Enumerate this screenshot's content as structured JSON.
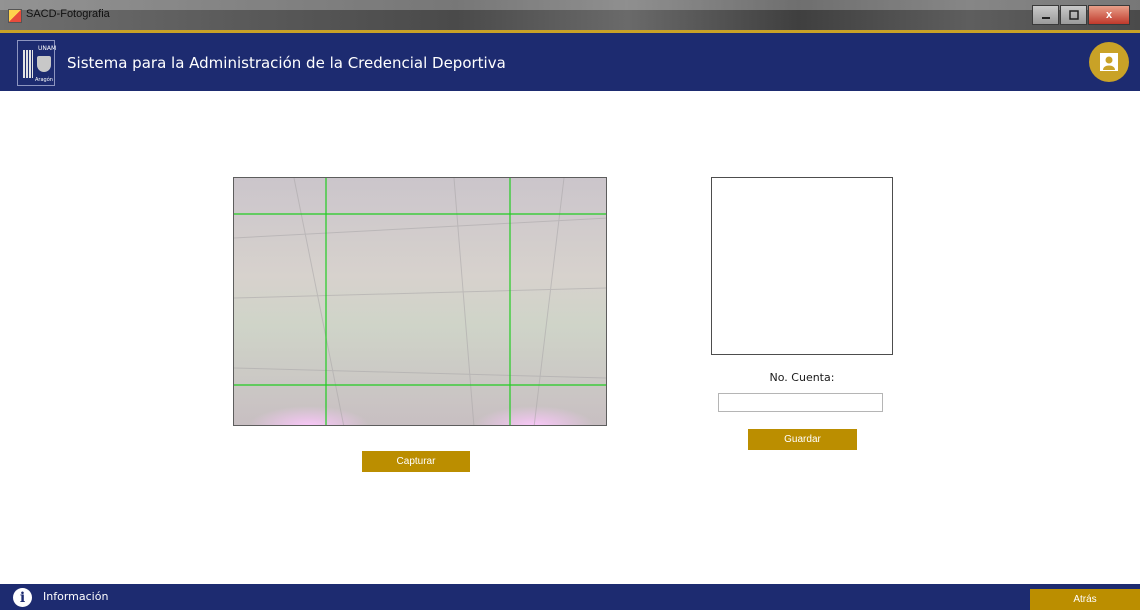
{
  "window": {
    "title": "SACD-Fotografia",
    "controls": [
      "minimize",
      "maximize",
      "close"
    ],
    "close_label": "x"
  },
  "header": {
    "logo": {
      "line1": "UNAM",
      "line2": "Aragón",
      "icon": "unam-logo"
    },
    "title": "Sistema para la Administración de la Credencial Deportiva",
    "user_icon": "portrait-icon"
  },
  "camera": {
    "icon": "webcam-feed",
    "grid_color": "#22cc22"
  },
  "form": {
    "account_label": "No. Cuenta:",
    "account_value": "",
    "save_label": "Guardar",
    "capture_label": "Capturar"
  },
  "footer": {
    "info_label": "Información",
    "info_icon": "info-icon",
    "back_label": "Atrás"
  },
  "colors": {
    "navy": "#1d2b70",
    "gold": "#c9a227",
    "button_gold": "#bb8e00"
  }
}
